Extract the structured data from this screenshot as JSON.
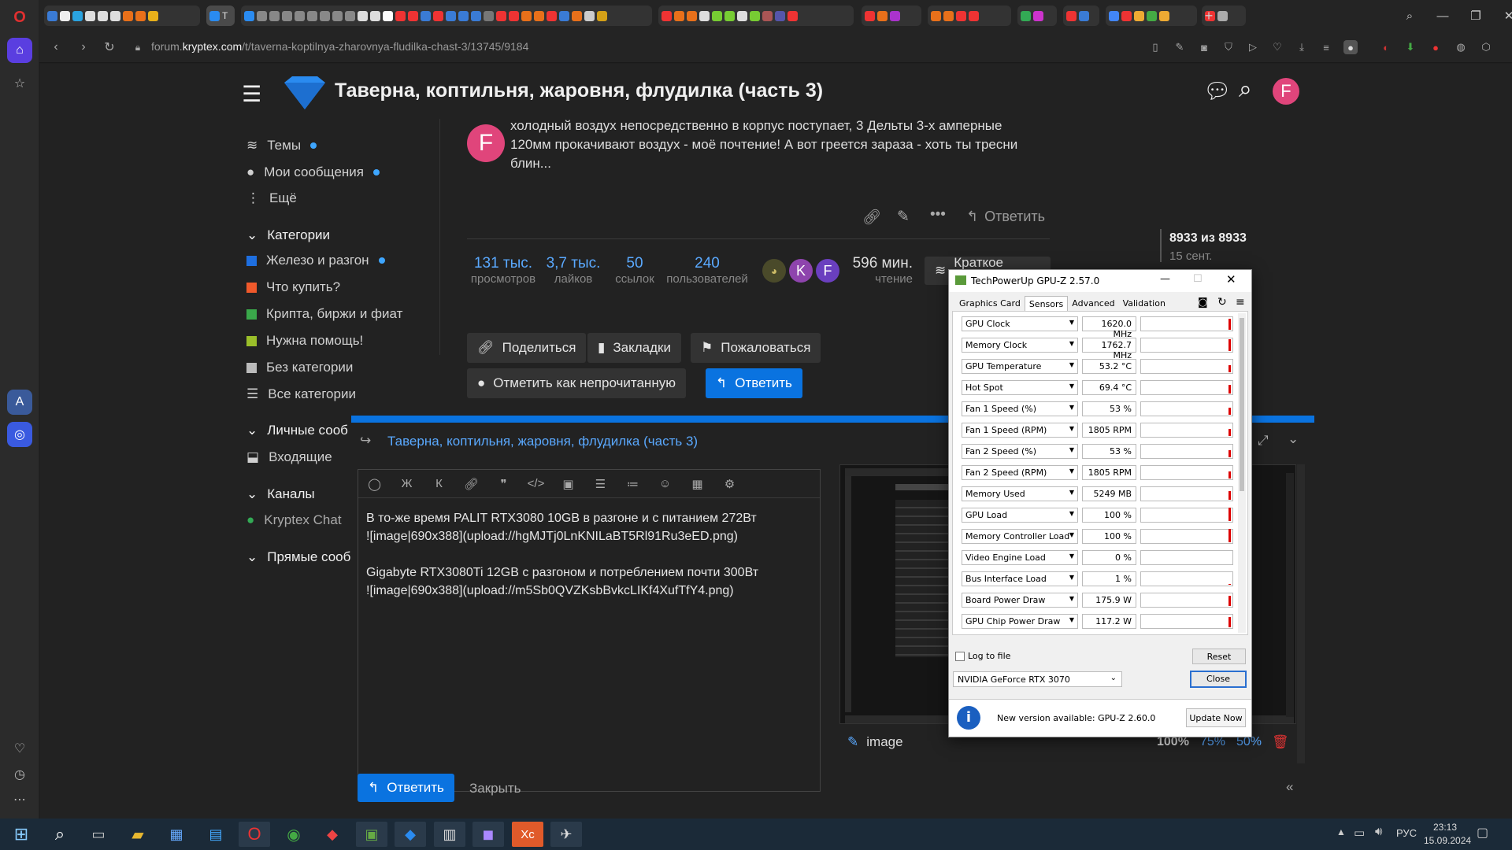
{
  "browser": {
    "url_prefix": "forum.",
    "url_domain": "kryptex.com",
    "url_path": "/t/taverna-koptilnya-zharovnya-fludilka-chast-3/13745/9184",
    "active_tab_label": "T"
  },
  "forum": {
    "title": "Таверна, коптильня, жаровня, флудилка (часть 3)",
    "user_initial": "F",
    "nav": {
      "topics": "Темы",
      "my_posts": "Мои сообщения",
      "more": "Ещё",
      "categories_header": "Категории",
      "categories": [
        {
          "label": "Железо и разгон",
          "color": "#1e6fe0",
          "dot": true
        },
        {
          "label": "Что купить?",
          "color": "#f0592b",
          "dot": false
        },
        {
          "label": "Крипта, биржи и фиат",
          "color": "#3aa84a",
          "dot": false
        },
        {
          "label": "Нужна помощь!",
          "color": "#9bbf2a",
          "dot": false
        },
        {
          "label": "Без категории",
          "color": "#bbbbbb",
          "dot": false
        }
      ],
      "all_categories": "Все категории",
      "personal_header": "Личные сооб",
      "inbox": "Входящие",
      "channels_header": "Каналы",
      "chat": "Kryptex Chat",
      "direct_header": "Прямые сооб"
    },
    "post": {
      "avatar_initial": "F",
      "text": "холодный воздух непосредственно в корпус поступает, 3 Дельты 3-х амперные 120мм прокачивают воздух - моё почтение! А вот греется зараза - хоть ты тресни блин...",
      "reply_label": "Ответить"
    },
    "stats": [
      {
        "n": "131 тыс.",
        "l": "просмотров"
      },
      {
        "n": "3,7 тыс.",
        "l": "лайков"
      },
      {
        "n": "50",
        "l": "ссылок"
      },
      {
        "n": "240",
        "l": "пользователей"
      }
    ],
    "participants": [
      "K",
      "F"
    ],
    "read_time": {
      "n": "596 мин.",
      "l": "чтение"
    },
    "summary_btn": "Краткое содерж",
    "buttons": {
      "share": "Поделиться",
      "bookmarks": "Закладки",
      "flag": "Пожаловаться",
      "mark_unread": "Отметить как непрочитанную",
      "reply": "Ответить"
    },
    "timeline": {
      "position": "8933 из 8933",
      "date": "15 сент."
    }
  },
  "composer": {
    "topic": "Таверна, коптильня, жаровня, флудилка (часть 3)",
    "text": "В то-же время PALIT RTX3080 10GB в разгоне и с питанием 272Вт\n![image|690x388](upload://hgMJTj0LnKNILaBT5Rl91Ru3eED.png)\n\nGigabyte RTX3080Ti 12GB с разгоном и потреблением почти 300Вт\n![image|690x388](upload://m5Sb0QVZKsbBvkcLIKf4XufTfY4.png)",
    "preview_image_label": "image",
    "zoom": [
      "100%",
      "75%",
      "50%"
    ],
    "submit": "Ответить",
    "close": "Закрыть"
  },
  "gpuz": {
    "title": "TechPowerUp GPU-Z 2.57.0",
    "tabs": [
      "Graphics Card",
      "Sensors",
      "Advanced",
      "Validation"
    ],
    "active_tab": "Sensors",
    "sensors": [
      {
        "name": "GPU Clock",
        "value": "1620.0 MHz",
        "level": 0.85
      },
      {
        "name": "Memory Clock",
        "value": "1762.7 MHz",
        "level": 0.9
      },
      {
        "name": "GPU Temperature",
        "value": "53.2 °C",
        "level": 0.55
      },
      {
        "name": "Hot Spot",
        "value": "69.4 °C",
        "level": 0.65
      },
      {
        "name": "Fan 1 Speed (%)",
        "value": "53 %",
        "level": 0.55
      },
      {
        "name": "Fan 1 Speed (RPM)",
        "value": "1805 RPM",
        "level": 0.55
      },
      {
        "name": "Fan 2 Speed (%)",
        "value": "53 %",
        "level": 0.55
      },
      {
        "name": "Fan 2 Speed (RPM)",
        "value": "1805 RPM",
        "level": 0.55
      },
      {
        "name": "Memory Used",
        "value": "5249 MB",
        "level": 0.65
      },
      {
        "name": "GPU Load",
        "value": "100 %",
        "level": 1.0
      },
      {
        "name": "Memory Controller Load",
        "value": "100 %",
        "level": 1.0
      },
      {
        "name": "Video Engine Load",
        "value": "0 %",
        "level": 0.0
      },
      {
        "name": "Bus Interface Load",
        "value": "1 %",
        "level": 0.05
      },
      {
        "name": "Board Power Draw",
        "value": "175.9 W",
        "level": 0.75
      },
      {
        "name": "GPU Chip Power Draw",
        "value": "117.2 W",
        "level": 0.75
      }
    ],
    "log_to_file": "Log to file",
    "reset": "Reset",
    "gpu_select": "NVIDIA GeForce RTX 3070",
    "close": "Close",
    "update_text": "New version available: GPU-Z 2.60.0",
    "update_btn": "Update Now"
  },
  "taskbar": {
    "lang": "РУС",
    "time": "23:13",
    "date": "15.09.2024"
  },
  "colors": {
    "accent": "#0a73e0",
    "avatar_pink": "#e0457b",
    "avatar_purple": "#8e44ad"
  }
}
